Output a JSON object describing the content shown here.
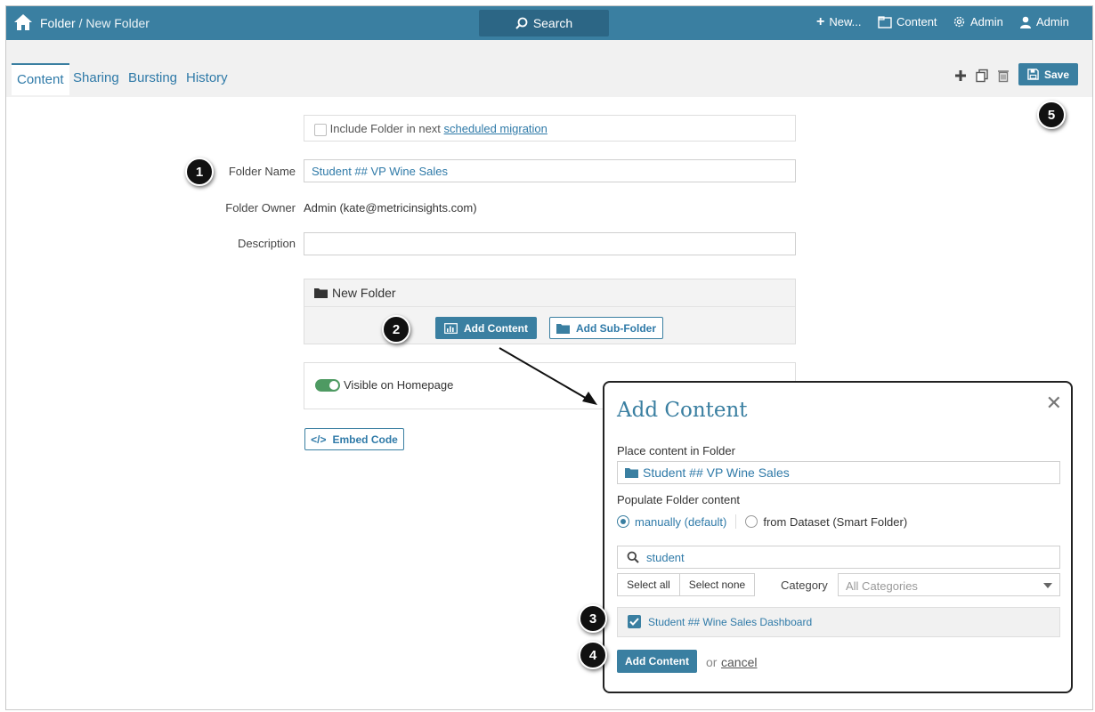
{
  "topbar": {
    "breadcrumb_root": "Folder",
    "breadcrumb_sep": "/",
    "breadcrumb_current": "New Folder",
    "search_label": "Search",
    "nav": [
      {
        "label": "New...",
        "icon": "plus-icon"
      },
      {
        "label": "Content",
        "icon": "content-icon"
      },
      {
        "label": "Admin",
        "icon": "gear-icon"
      },
      {
        "label": "Admin",
        "icon": "user-icon"
      }
    ]
  },
  "tabs": [
    {
      "label": "Content",
      "active": true
    },
    {
      "label": "Sharing",
      "active": false
    },
    {
      "label": "Bursting",
      "active": false
    },
    {
      "label": "History",
      "active": false
    }
  ],
  "toolbar": {
    "save_label": "Save"
  },
  "form": {
    "migration_text": "Include Folder in next",
    "migration_link": "scheduled migration",
    "folder_name_label": "Folder Name",
    "folder_name_value": "Student ## VP Wine Sales",
    "folder_owner_label": "Folder Owner",
    "folder_owner_value": "Admin (kate@metricinsights.com)",
    "description_label": "Description",
    "description_value": "",
    "folder_panel_title": "New Folder",
    "add_content_label": "Add Content",
    "add_subfolder_label": "Add Sub-Folder",
    "visible_homepage_label": "Visible on Homepage",
    "visible_homepage_on": true,
    "embed_code_label": "Embed Code"
  },
  "modal": {
    "title": "Add Content",
    "place_label": "Place content in Folder",
    "place_value": "Student ## VP Wine Sales",
    "populate_label": "Populate Folder content",
    "radio_manual": "manually (default)",
    "radio_dataset": "from Dataset (Smart Folder)",
    "search_value": "student",
    "select_all": "Select all",
    "select_none": "Select none",
    "category_label": "Category",
    "category_value": "All Categories",
    "results": [
      {
        "label": "Student ## Wine Sales Dashboard",
        "checked": true
      }
    ],
    "submit_label": "Add Content",
    "or_text": "or",
    "cancel_label": "cancel"
  },
  "callouts": [
    "1",
    "2",
    "3",
    "4",
    "5"
  ],
  "colors": {
    "brand": "#3a7fa1",
    "brand_dark": "#2c6685",
    "toggle_on": "#4e9a62",
    "link": "#2f7aa8"
  }
}
